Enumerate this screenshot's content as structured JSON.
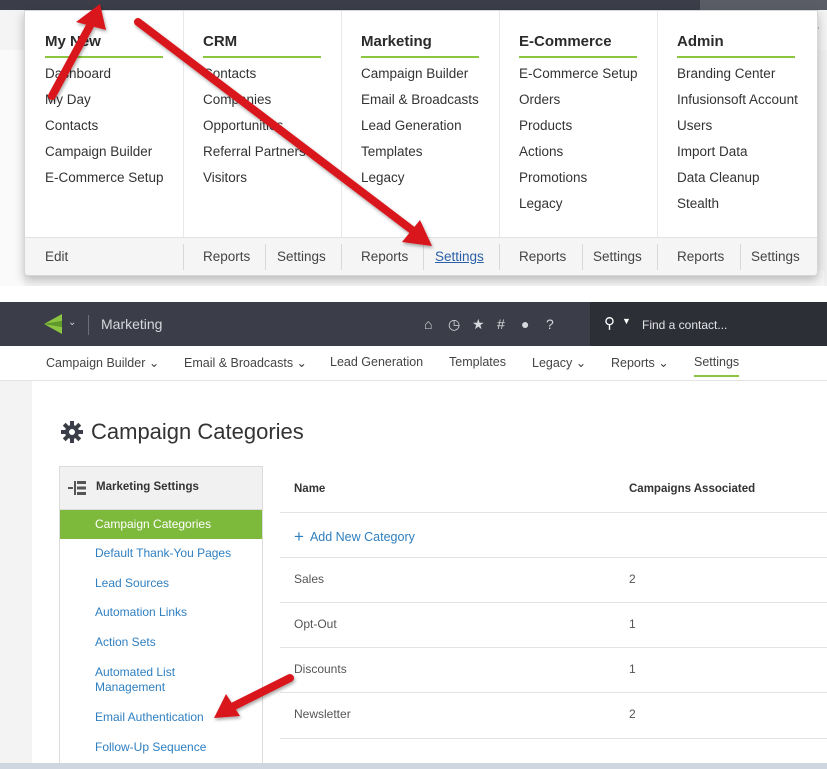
{
  "mega_menu": {
    "columns": [
      {
        "heading": "My New",
        "items": [
          "Dashboard",
          "My Day",
          "Contacts",
          "Campaign Builder",
          "E-Commerce Setup"
        ]
      },
      {
        "heading": "CRM",
        "items": [
          "Contacts",
          "Companies",
          "Opportunities",
          "Referral Partners",
          "Visitors"
        ]
      },
      {
        "heading": "Marketing",
        "items": [
          "Campaign Builder",
          "Email & Broadcasts",
          "Lead Generation",
          "Templates",
          "Legacy"
        ]
      },
      {
        "heading": "E-Commerce",
        "items": [
          "E-Commerce Setup",
          "Orders",
          "Products",
          "Actions",
          "Promotions",
          "Legacy"
        ]
      },
      {
        "heading": "Admin",
        "items": [
          "Branding Center",
          "Infusionsoft Account",
          "Users",
          "Import Data",
          "Data Cleanup",
          "Stealth"
        ]
      }
    ],
    "footer": {
      "edit": "Edit",
      "crm_reports": "Reports",
      "crm_settings": "Settings",
      "marketing_reports": "Reports",
      "marketing_settings": "Settings",
      "ecommerce_reports": "Reports",
      "ecommerce_settings": "Settings",
      "admin_reports": "Reports",
      "admin_settings": "Settings"
    }
  },
  "app_bar": {
    "title": "Marketing",
    "icons": [
      "home-icon",
      "history-icon",
      "star-icon",
      "hashtag-icon",
      "user-icon",
      "help-icon"
    ],
    "search_placeholder": "Find a contact..."
  },
  "subnav": {
    "items": [
      "Campaign Builder ⌄",
      "Email & Broadcasts ⌄",
      "Lead Generation",
      "Templates",
      "Legacy ⌄",
      "Reports ⌄",
      "Settings"
    ],
    "active": "Settings"
  },
  "page": {
    "title": "Campaign Categories"
  },
  "sidebar": {
    "heading": "Marketing Settings",
    "items": [
      "Campaign Categories",
      "Default Thank-You Pages",
      "Lead Sources",
      "Automation Links",
      "Action Sets",
      "Automated List Management",
      "Email Authentication",
      "Follow-Up Sequence"
    ],
    "active": "Campaign Categories"
  },
  "table": {
    "headers": {
      "name": "Name",
      "count": "Campaigns Associated"
    },
    "add_label": "Add New Category",
    "rows": [
      {
        "name": "Sales",
        "count": "2"
      },
      {
        "name": "Opt-Out",
        "count": "1"
      },
      {
        "name": "Discounts",
        "count": "1"
      },
      {
        "name": "Newsletter",
        "count": "2"
      }
    ]
  },
  "colors": {
    "accent": "#8cc640",
    "dark_bar": "#3b3e48",
    "link": "#2f7fc0",
    "arrow": "#d9171e"
  }
}
